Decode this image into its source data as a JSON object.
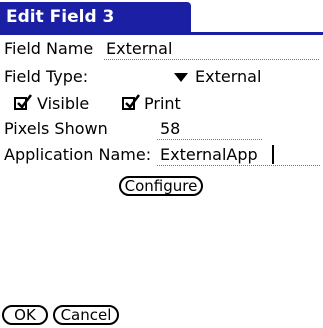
{
  "title": "Edit Field 3",
  "field_name": {
    "label": "Field Name",
    "value": "External"
  },
  "field_type": {
    "label": "Field Type:",
    "selected": "External"
  },
  "checkboxes": [
    {
      "label": "Visible",
      "checked": true
    },
    {
      "label": "Print",
      "checked": true
    }
  ],
  "pixels_shown": {
    "label": "Pixels Shown",
    "value": "58"
  },
  "application_name": {
    "label": "Application Name:",
    "value": "ExternalApp"
  },
  "buttons": {
    "configure": "Configure",
    "ok": "OK",
    "cancel": "Cancel"
  },
  "colors": {
    "title_bar": "#1a1fa3",
    "title_text": "#ffffff"
  }
}
